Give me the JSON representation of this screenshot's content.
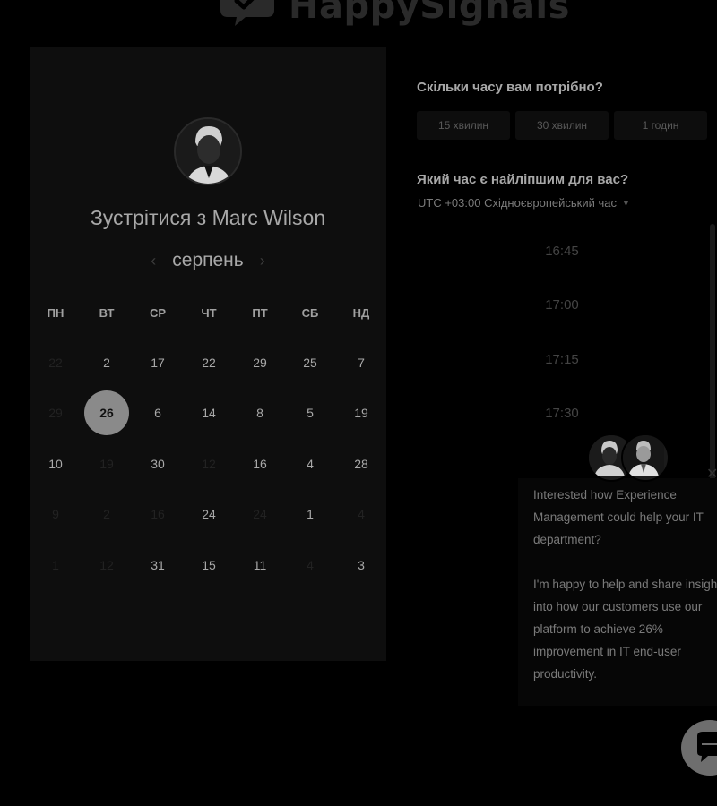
{
  "header": {
    "brand": "HappySignals"
  },
  "calendar": {
    "title_prefix": "Зустрітися з",
    "host_name": "Marc Wilson",
    "month": "серпень",
    "prev_icon": "chevron-left-icon",
    "next_icon": "chevron-right-icon",
    "weekdays": [
      "ПН",
      "ВТ",
      "СР",
      "ЧТ",
      "ПТ",
      "СБ",
      "НД"
    ],
    "weeks": [
      [
        {
          "d": "22",
          "s": "dim"
        },
        {
          "d": "2",
          "s": "on"
        },
        {
          "d": "17",
          "s": "on"
        },
        {
          "d": "22",
          "s": "on"
        },
        {
          "d": "29",
          "s": "on"
        },
        {
          "d": "25",
          "s": "on"
        },
        {
          "d": "7",
          "s": "on"
        }
      ],
      [
        {
          "d": "29",
          "s": "dim"
        },
        {
          "d": "26",
          "s": "sel"
        },
        {
          "d": "6",
          "s": "on"
        },
        {
          "d": "14",
          "s": "on"
        },
        {
          "d": "8",
          "s": "on"
        },
        {
          "d": "5",
          "s": "on"
        },
        {
          "d": "19",
          "s": "on"
        }
      ],
      [
        {
          "d": "10",
          "s": "on"
        },
        {
          "d": "19",
          "s": "dim"
        },
        {
          "d": "30",
          "s": "on"
        },
        {
          "d": "12",
          "s": "dim"
        },
        {
          "d": "16",
          "s": "on"
        },
        {
          "d": "4",
          "s": "on"
        },
        {
          "d": "28",
          "s": "on"
        }
      ],
      [
        {
          "d": "9",
          "s": "dim"
        },
        {
          "d": "2",
          "s": "dim"
        },
        {
          "d": "16",
          "s": "dim"
        },
        {
          "d": "24",
          "s": "on"
        },
        {
          "d": "24",
          "s": "dim"
        },
        {
          "d": "1",
          "s": "on"
        },
        {
          "d": "4",
          "s": "dim"
        }
      ],
      [
        {
          "d": "1",
          "s": "dim"
        },
        {
          "d": "12",
          "s": "dim"
        },
        {
          "d": "31",
          "s": "on"
        },
        {
          "d": "15",
          "s": "on"
        },
        {
          "d": "11",
          "s": "on"
        },
        {
          "d": "4",
          "s": "dim"
        },
        {
          "d": "3",
          "s": "on"
        }
      ]
    ]
  },
  "booking": {
    "duration_question": "Скільки часу вам потрібно?",
    "durations": [
      "15 хвилин",
      "30 хвилин",
      "1 годин"
    ],
    "time_question": "Який час є найліпшим для вас?",
    "timezone": "UTC +03:00 Східноєвропейський час",
    "timezone_icon": "caret-down-icon",
    "slots": [
      "16:45",
      "17:00",
      "17:15",
      "17:30"
    ]
  },
  "chat": {
    "message_1": "Interested how Experience Management could help your IT department?",
    "message_2": "I'm happy to help and share insight into how our customers use our platform to achieve 26% improvement in IT end-user productivity.",
    "close_icon": "close-icon",
    "launcher_icon": "chat-bubble-icon"
  }
}
